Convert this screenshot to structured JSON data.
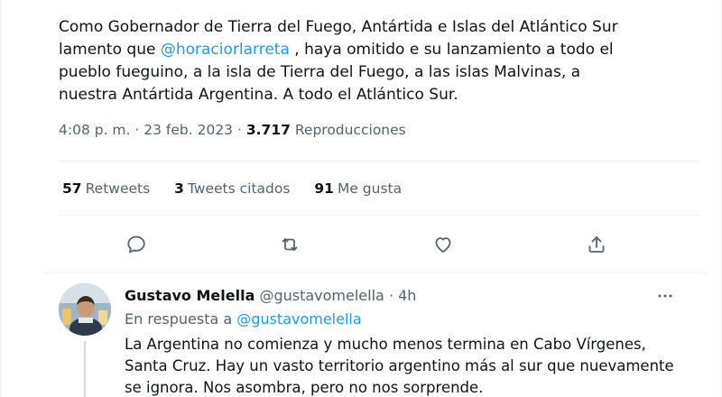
{
  "tweet": {
    "text_before": "Como Gobernador de Tierra del Fuego, Antártida e Islas del Atlántico Sur\nlamento que ",
    "mention": "@horaciorlarreta",
    "text_after": " , haya omitido e su lanzamiento a todo el\npueblo fueguino, a la isla de Tierra del Fuego, a las islas Malvinas, a\nnuestra Antártida Argentina.  A todo el Atlántico Sur.",
    "time": "4:08 p. m.",
    "date": "23 feb. 2023",
    "views_count": "3.717",
    "views_label": "Reproducciones",
    "separator": "·"
  },
  "stats": {
    "retweets_count": "57",
    "retweets_label": "Retweets",
    "quotes_count": "3",
    "quotes_label": "Tweets citados",
    "likes_count": "91",
    "likes_label": "Me gusta"
  },
  "actions": [
    {
      "name": "reply-icon"
    },
    {
      "name": "retweet-icon"
    },
    {
      "name": "like-icon"
    },
    {
      "name": "share-icon"
    }
  ],
  "reply": {
    "name": "Gustavo Melella",
    "handle": "@gustavomelella",
    "separator": "·",
    "time": "4h",
    "reply_prefix": "En respuesta a ",
    "reply_mention": "@gustavomelella",
    "text": "La Argentina no comienza y mucho menos termina en Cabo Vírgenes,\nSanta Cruz. Hay un vasto territorio argentino más al sur que nuevamente\nse ignora. Nos asombra, pero no nos sorprende."
  },
  "colors": {
    "accent": "#1d9bf0",
    "text": "#0f1419",
    "secondary": "#536471",
    "divider": "#eff3f4"
  }
}
